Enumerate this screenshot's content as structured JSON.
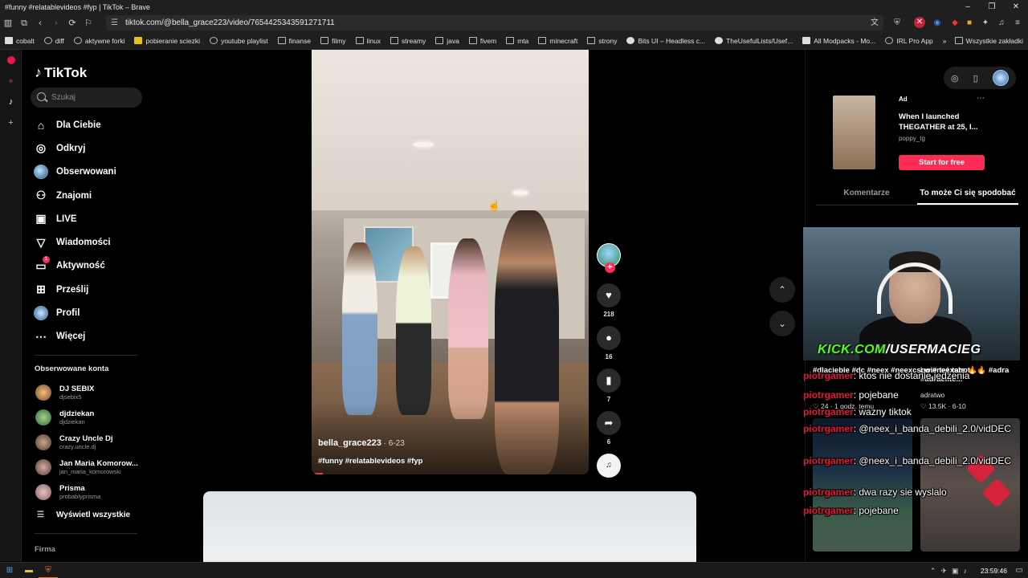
{
  "window": {
    "title": "#funny #relatablevideos #fyp | TikTok – Brave"
  },
  "browser": {
    "url": "tiktok.com/@bella_grace223/video/7654425343591271711",
    "bookmarks": [
      "cobalt",
      "diff",
      "aktywne forki",
      "pobieranie sciezki",
      "youtube playlist",
      "finanse",
      "filmy",
      "linux",
      "streamy",
      "java",
      "fivem",
      "mta",
      "minecraft",
      "strony",
      "Bits UI – Headless c...",
      "TheUsefulLists/Usef...",
      "All Modpacks - Mo...",
      "IRL Pro App"
    ],
    "bookmarks_more": "»",
    "all_bookmarks": "Wszystkie zakładki"
  },
  "tiktok": {
    "logo": "TikTok",
    "search_placeholder": "Szukaj",
    "nav": [
      {
        "label": "Dla Ciebie",
        "icon": "home-icon"
      },
      {
        "label": "Odkryj",
        "icon": "compass-icon"
      },
      {
        "label": "Obserwowani",
        "icon": "following-icon"
      },
      {
        "label": "Znajomi",
        "icon": "friends-icon"
      },
      {
        "label": "LIVE",
        "icon": "live-icon"
      },
      {
        "label": "Wiadomości",
        "icon": "messages-icon"
      },
      {
        "label": "Aktywność",
        "icon": "activity-icon",
        "badge": "1"
      },
      {
        "label": "Prześlij",
        "icon": "upload-icon"
      },
      {
        "label": "Profil",
        "icon": "profile-icon"
      },
      {
        "label": "Więcej",
        "icon": "more-icon"
      }
    ],
    "following_title": "Obserwowane konta",
    "following": [
      {
        "name": "DJ SEBIX",
        "user": "djsebix5"
      },
      {
        "name": "djdziekan",
        "user": "djdziekan"
      },
      {
        "name": "Crazy Uncle Dj",
        "user": "crazy.uncle.dj"
      },
      {
        "name": "Jan Maria Komorow...",
        "user": "jan_maria_komorowski"
      },
      {
        "name": "Prisma",
        "user": "probablyprisma"
      }
    ],
    "show_all": "Wyświetl wszystkie",
    "company": "Firma"
  },
  "video": {
    "author": "bella_grace223",
    "date": " · 6-23",
    "caption": "#funny #relatablevideos #fyp",
    "likes": "218",
    "comments": "16",
    "saves": "7",
    "shares": "6",
    "progress_fraction": 0.04
  },
  "right": {
    "ad": {
      "label": "Ad",
      "title": "When I launched THEGATHER at 25, I...",
      "account": "poppy_tg",
      "cta": "Start for free"
    },
    "tabs": [
      "Komentarze",
      "To może Ci się spodobać"
    ],
    "webcam_brand_a": "KICK.COM",
    "webcam_brand_b": "/USERMACIEG",
    "rec_meta_1": "♡ 24 · 1 godz. temu",
    "rec_user_2": "adratwo",
    "rec_meta_2": "♡ 13.5K · 6-10",
    "rec_title_1": "#dlaciebie #dc #neex #neexcsgo #neexshot...",
    "rec_title_2": "i wie też tata 🔥🔥 #adra #adraelite..."
  },
  "chat": [
    {
      "nick": "piotrgamer",
      "msg": ": ktos nie dostanie jedzenia"
    },
    {
      "nick": "piotrgamer",
      "msg": ": pojebane"
    },
    {
      "nick": "piotrgamer",
      "msg": ": wazny tiktok"
    },
    {
      "nick": "piotrgamer",
      "msg": ": @neex_i_banda_debili_2.0/vidDEC"
    },
    {
      "nick": "piotrgamer",
      "msg": ": @neex_i_banda_debili_2.0/vidDEC"
    },
    {
      "nick": "piotrgamer",
      "msg": ": dwa razy sie wyslalo"
    },
    {
      "nick": "piotrgamer",
      "msg": ": pojebane"
    }
  ],
  "taskbar": {
    "time": "23:59:46"
  },
  "colors": {
    "accent": "#fe2c55",
    "chat_nick": "#e31937",
    "kick_green": "#53fc18"
  }
}
